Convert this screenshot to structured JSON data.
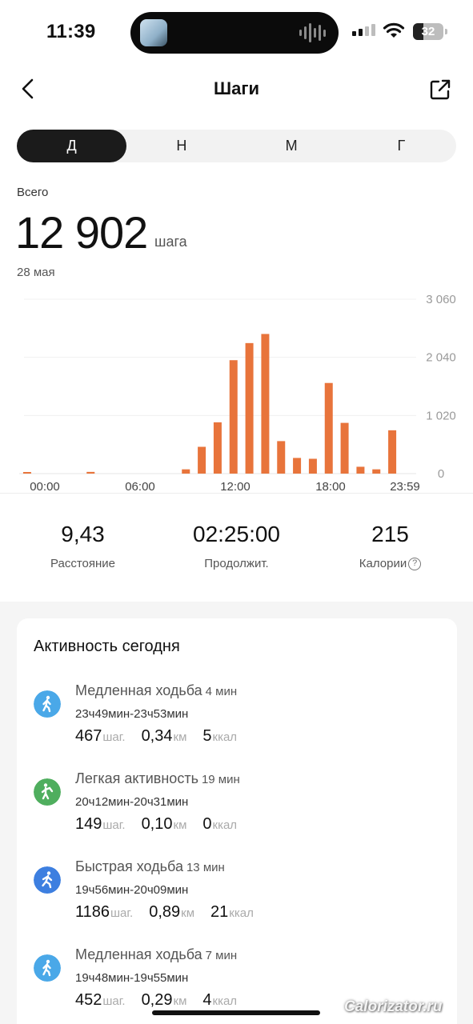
{
  "status_bar": {
    "time": "11:39",
    "battery": "32"
  },
  "header": {
    "title": "Шаги"
  },
  "tabs": [
    {
      "label": "Д",
      "active": true
    },
    {
      "label": "Н",
      "active": false
    },
    {
      "label": "М",
      "active": false
    },
    {
      "label": "Г",
      "active": false
    }
  ],
  "summary": {
    "label": "Всего",
    "value": "12 902",
    "unit": "шага",
    "date": "28 мая"
  },
  "chart_data": {
    "type": "bar",
    "x_tick_labels": [
      "00:00",
      "06:00",
      "12:00",
      "18:00",
      "23:59"
    ],
    "y_tick_labels": [
      "3 060",
      "2 040",
      "1 020",
      "0"
    ],
    "ylim": [
      0,
      3060
    ],
    "categories": [
      "00",
      "01",
      "02",
      "03",
      "04",
      "05",
      "06",
      "07",
      "08",
      "09",
      "10",
      "11",
      "12",
      "13",
      "14",
      "15",
      "16",
      "17",
      "18",
      "19",
      "20",
      "21",
      "22",
      "23"
    ],
    "values": [
      15,
      0,
      0,
      0,
      30,
      0,
      0,
      0,
      0,
      0,
      75,
      470,
      900,
      1990,
      2290,
      2450,
      570,
      275,
      260,
      1590,
      890,
      120,
      75,
      760
    ],
    "color": "#e8743b",
    "grid": true
  },
  "stats": [
    {
      "value": "9,43",
      "label": "Расстояние",
      "info": false
    },
    {
      "value": "02:25:00",
      "label": "Продолжит.",
      "info": false
    },
    {
      "value": "215",
      "label": "Калории",
      "info": true
    }
  ],
  "activity": {
    "title": "Активность сегодня",
    "items": [
      {
        "name": "Медленная ходьба",
        "duration": "4 мин",
        "time": "23ч49мин-23ч53мин",
        "steps": "467",
        "steps_unit": "шаг.",
        "distance": "0,34",
        "distance_unit": "км",
        "calories": "5",
        "calories_unit": "ккал",
        "icon": "walking-icon",
        "color": "#4aa8e8"
      },
      {
        "name": "Легкая активность",
        "duration": "19 мин",
        "time": "20ч12мин-20ч31мин",
        "steps": "149",
        "steps_unit": "шаг.",
        "distance": "0,10",
        "distance_unit": "км",
        "calories": "0",
        "calories_unit": "ккал",
        "icon": "light-activity-icon",
        "color": "#4fae5e"
      },
      {
        "name": "Быстрая ходьба",
        "duration": "13 мин",
        "time": "19ч56мин-20ч09мин",
        "steps": "1186",
        "steps_unit": "шаг.",
        "distance": "0,89",
        "distance_unit": "км",
        "calories": "21",
        "calories_unit": "ккал",
        "icon": "fast-walking-icon",
        "color": "#3d7fe0"
      },
      {
        "name": "Медленная ходьба",
        "duration": "7 мин",
        "time": "19ч48мин-19ч55мин",
        "steps": "452",
        "steps_unit": "шаг.",
        "distance": "0,29",
        "distance_unit": "км",
        "calories": "4",
        "calories_unit": "ккал",
        "icon": "walking-icon",
        "color": "#4aa8e8"
      }
    ]
  },
  "watermark": "Calorizator.ru"
}
